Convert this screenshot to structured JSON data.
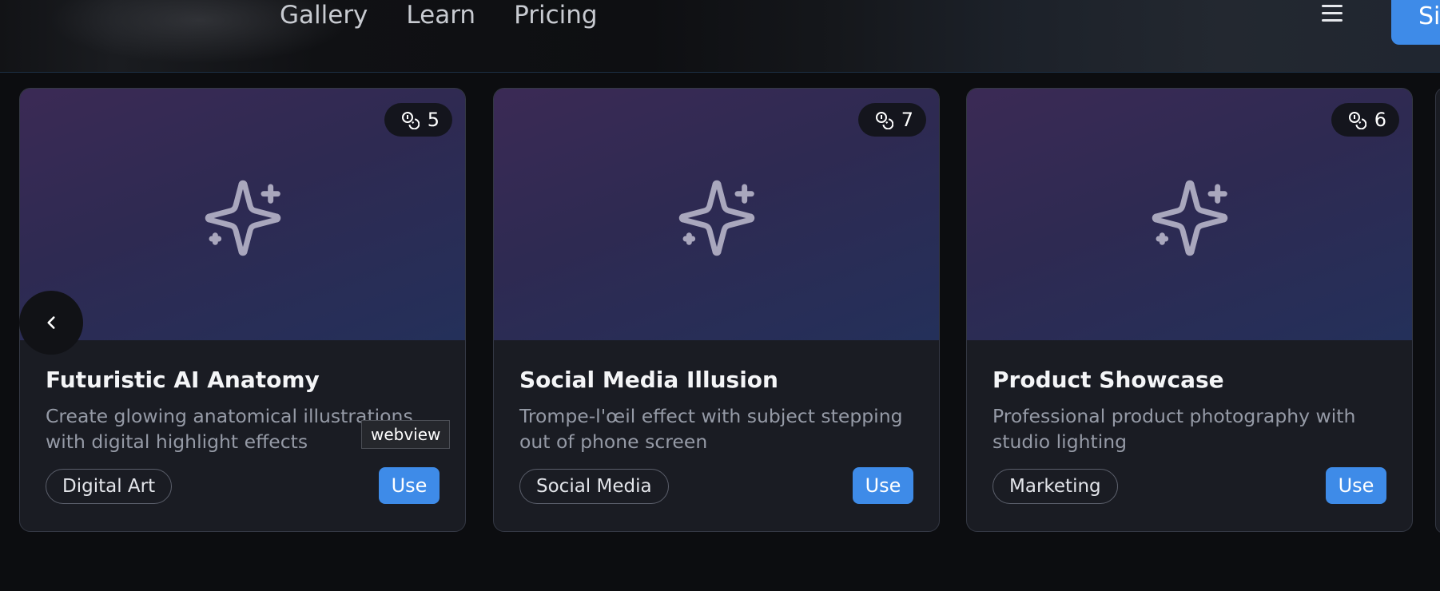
{
  "nav": {
    "links": [
      "Gallery",
      "Learn",
      "Pricing"
    ],
    "signin_label": "Sig"
  },
  "cards": [
    {
      "credits": "5",
      "title": "Futuristic AI Anatomy",
      "description": "Create glowing anatomical illustrations with digital highlight effects",
      "tag": "Digital Art",
      "action": "Use"
    },
    {
      "credits": "7",
      "title": "Social Media Illusion",
      "description": "Trompe-l'œil effect with subject stepping out of phone screen",
      "tag": "Social Media",
      "action": "Use"
    },
    {
      "credits": "6",
      "title": "Product Showcase",
      "description": "Professional product photography with studio lighting",
      "tag": "Marketing",
      "action": "Use"
    }
  ],
  "tooltip": "webview",
  "colors": {
    "accent": "#3e8be8",
    "card_bg": "#1a1c23",
    "page_bg": "#0c0d10"
  },
  "icons": {
    "credits": "coins-icon",
    "placeholder": "sparkles-icon",
    "prev": "chevron-left-icon",
    "menu": "hamburger-menu-icon"
  }
}
